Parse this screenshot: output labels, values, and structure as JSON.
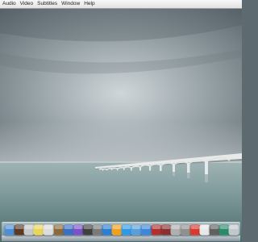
{
  "menubar": {
    "items": [
      {
        "label": "Audio"
      },
      {
        "label": "Video"
      },
      {
        "label": "Subtitles"
      },
      {
        "label": "Window"
      },
      {
        "label": "Help"
      }
    ]
  },
  "wallpaper": {
    "icon": "wallpaper-bridge-over-sea",
    "sky_color": "#aab4b8",
    "sea_color": "#6a8a8c"
  },
  "dock": {
    "items": [
      {
        "icon": "finder-icon",
        "color": "#4d8fd6"
      },
      {
        "icon": "coffee-cup-icon",
        "color": "#5b3a24"
      },
      {
        "icon": "photo-icon",
        "color": "#c8c8c8"
      },
      {
        "icon": "notes-icon",
        "color": "#e8d65a"
      },
      {
        "icon": "pencil-icon",
        "color": "#dcdcdc"
      },
      {
        "icon": "feather-icon",
        "color": "#8a6a3a"
      },
      {
        "icon": "globe-compass-icon",
        "color": "#3a6fc4"
      },
      {
        "icon": "star-app-icon",
        "color": "#7a52c8"
      },
      {
        "icon": "timer-icon",
        "color": "#404040"
      },
      {
        "icon": "system-preferences-icon",
        "color": "#7a7a7a"
      },
      {
        "icon": "music-icon",
        "color": "#2a7fd4"
      },
      {
        "icon": "vlc-cone-icon",
        "color": "#f0a020"
      },
      {
        "icon": "safari-icon",
        "color": "#2d9ae8"
      },
      {
        "icon": "mail-icon",
        "color": "#5aa0d8"
      },
      {
        "icon": "app-store-icon",
        "color": "#3d86d8"
      },
      {
        "icon": "paint-brush-icon",
        "color": "#b03030"
      },
      {
        "icon": "books-icon",
        "color": "#8a3030"
      },
      {
        "icon": "tools-icon",
        "color": "#b0b0b0"
      },
      {
        "icon": "disk-utility-icon",
        "color": "#909090"
      },
      {
        "icon": "calendar-icon",
        "color": "#d83a30"
      },
      {
        "icon": "document-icon",
        "color": "#e8e8e8"
      },
      {
        "icon": "dashboard-icon",
        "color": "#606060"
      },
      {
        "icon": "time-machine-icon",
        "color": "#2a8a6a"
      },
      {
        "icon": "trash-icon",
        "color": "#c0c8cc"
      }
    ]
  }
}
